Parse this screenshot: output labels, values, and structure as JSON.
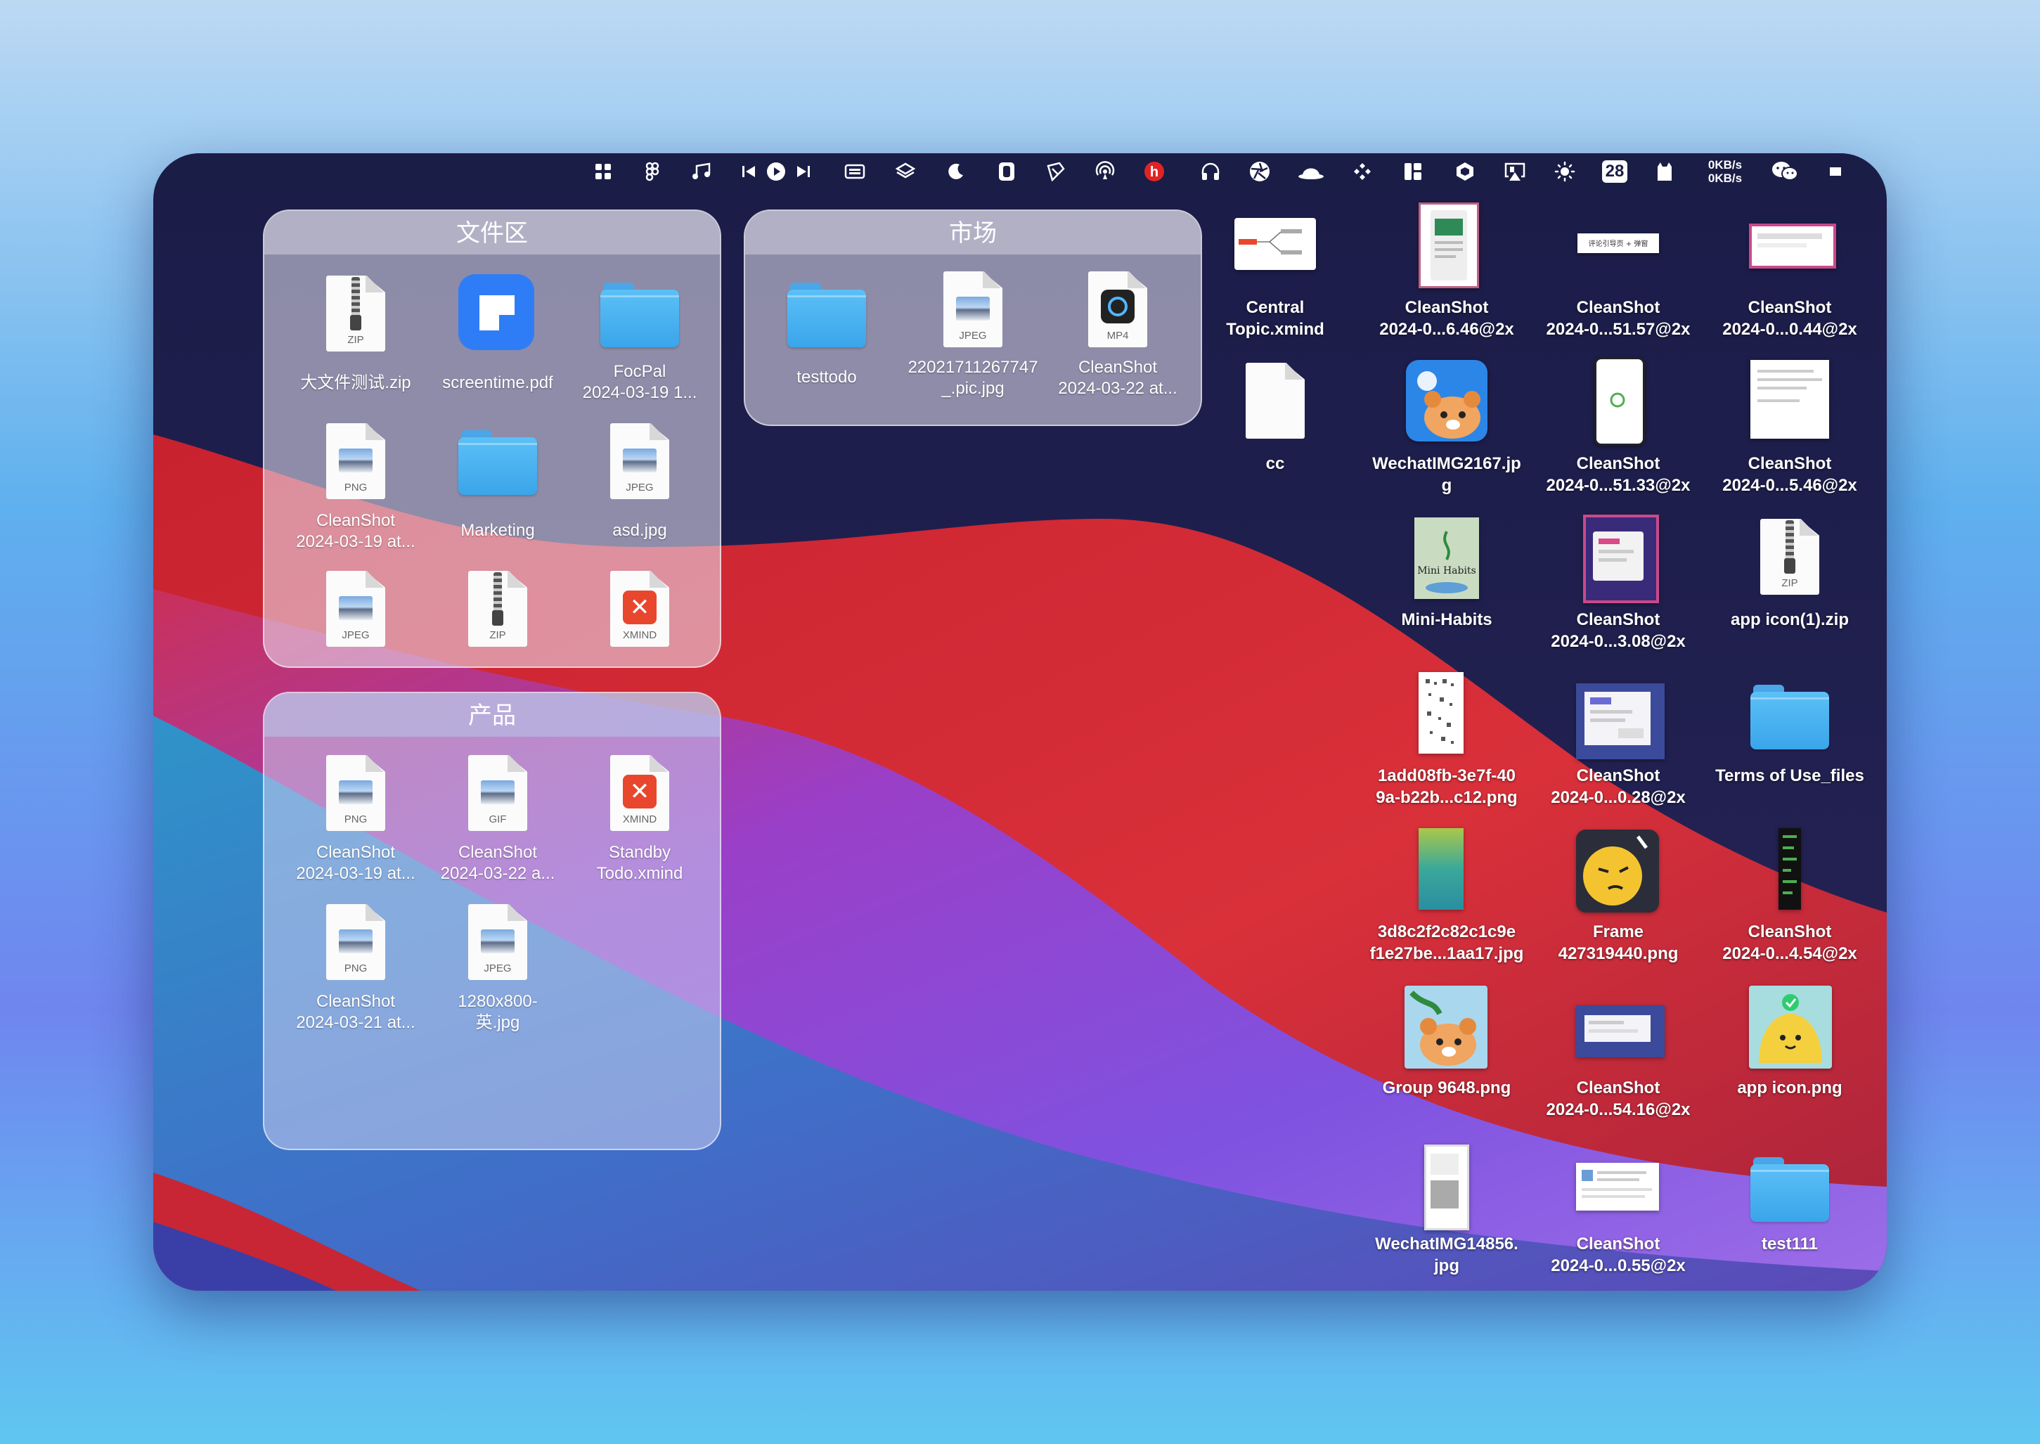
{
  "menubar": {
    "icons": [
      "grid-icon",
      "figma-icon",
      "music-note-icon",
      "previous-track-icon",
      "play-icon",
      "next-track-icon",
      "keyboard-icon",
      "layers-icon",
      "moon-icon",
      "dynamic-island-icon",
      "pencil-icon",
      "airdrop-icon",
      "h-badge-icon",
      "headphones-icon",
      "aperture-icon",
      "bowler-hat-icon",
      "command-icon",
      "layout-icon",
      "hexagon-icon",
      "airplay-icon",
      "brightness-icon",
      "cat-icon",
      "wechat-icon"
    ],
    "date_badge": "28",
    "network_up": "0KB/s",
    "network_down": "0KB/s"
  },
  "groups": {
    "files": {
      "title": "文件区",
      "items": [
        {
          "label": "大文件测试.zip",
          "type": "zip",
          "ext": "ZIP"
        },
        {
          "label": "screentime.pdf",
          "type": "pdf",
          "ext": ""
        },
        {
          "label": "FocPal\n2024-03-19 1...",
          "type": "folder",
          "ext": ""
        },
        {
          "label": "CleanShot\n2024-03-19 at...",
          "type": "image",
          "ext": "PNG"
        },
        {
          "label": "Marketing",
          "type": "folder",
          "ext": ""
        },
        {
          "label": "asd.jpg",
          "type": "image",
          "ext": "JPEG"
        },
        {
          "label": "",
          "type": "image",
          "ext": "JPEG"
        },
        {
          "label": "",
          "type": "zip",
          "ext": "ZIP"
        },
        {
          "label": "",
          "type": "xmind",
          "ext": "XMIND"
        }
      ]
    },
    "market": {
      "title": "市场",
      "items": [
        {
          "label": "testtodo",
          "type": "folder",
          "ext": ""
        },
        {
          "label": "22021711267747\n_.pic.jpg",
          "type": "image",
          "ext": "JPEG"
        },
        {
          "label": "CleanShot\n2024-03-22 at...",
          "type": "mp4",
          "ext": "MP4"
        }
      ]
    },
    "product": {
      "title": "产品",
      "items": [
        {
          "label": "CleanShot\n2024-03-19 at...",
          "type": "image",
          "ext": "PNG"
        },
        {
          "label": "CleanShot\n2024-03-22 a...",
          "type": "image",
          "ext": "GIF"
        },
        {
          "label": "Standby\nTodo.xmind",
          "type": "xmind",
          "ext": "XMIND"
        },
        {
          "label": "CleanShot\n2024-03-21 at...",
          "type": "image",
          "ext": "PNG"
        },
        {
          "label": "1280x800-\n英.jpg",
          "type": "image",
          "ext": "JPEG"
        }
      ]
    }
  },
  "desktop": {
    "items": [
      {
        "label": "Central\nTopic.xmind"
      },
      {
        "label": "CleanShot\n2024-0...6.46@2x"
      },
      {
        "label": "CleanShot\n2024-0...51.57@2x"
      },
      {
        "label": "CleanShot\n2024-0...0.44@2x"
      },
      {
        "label": "cc"
      },
      {
        "label": "WechatIMG2167.jp\ng"
      },
      {
        "label": "CleanShot\n2024-0...51.33@2x"
      },
      {
        "label": "CleanShot\n2024-0...5.46@2x"
      },
      {
        "label": "Mini-Habits"
      },
      {
        "label": "CleanShot\n2024-0...3.08@2x"
      },
      {
        "label": "app icon(1).zip"
      },
      {
        "label": "1add08fb-3e7f-40\n9a-b22b...c12.png"
      },
      {
        "label": "CleanShot\n2024-0...0.28@2x"
      },
      {
        "label": "Terms of Use_files"
      },
      {
        "label": "3d8c2f2c82c1c9e\nf1e27be...1aa17.jpg"
      },
      {
        "label": "Frame\n427319440.png"
      },
      {
        "label": "CleanShot\n2024-0...4.54@2x"
      },
      {
        "label": "Group 9648.png"
      },
      {
        "label": "CleanShot\n2024-0...54.16@2x"
      },
      {
        "label": "app icon.png"
      },
      {
        "label": "WechatIMG14856.\njpg"
      },
      {
        "label": "CleanShot\n2024-0...0.55@2x"
      },
      {
        "label": "test111"
      }
    ],
    "thumb_texts": {
      "minihabits_cover": "Mini Habits",
      "review_banner": "评论引导页 + 弹窗"
    }
  },
  "colors": {
    "wallpaper_navy": "#1f2150",
    "wallpaper_red": "#d22a35",
    "wallpaper_purple": "#8a4bd6",
    "wallpaper_blue": "#4a7fd4",
    "folder_blue": "#3aa5ea",
    "xmind_red": "#e8472e"
  }
}
